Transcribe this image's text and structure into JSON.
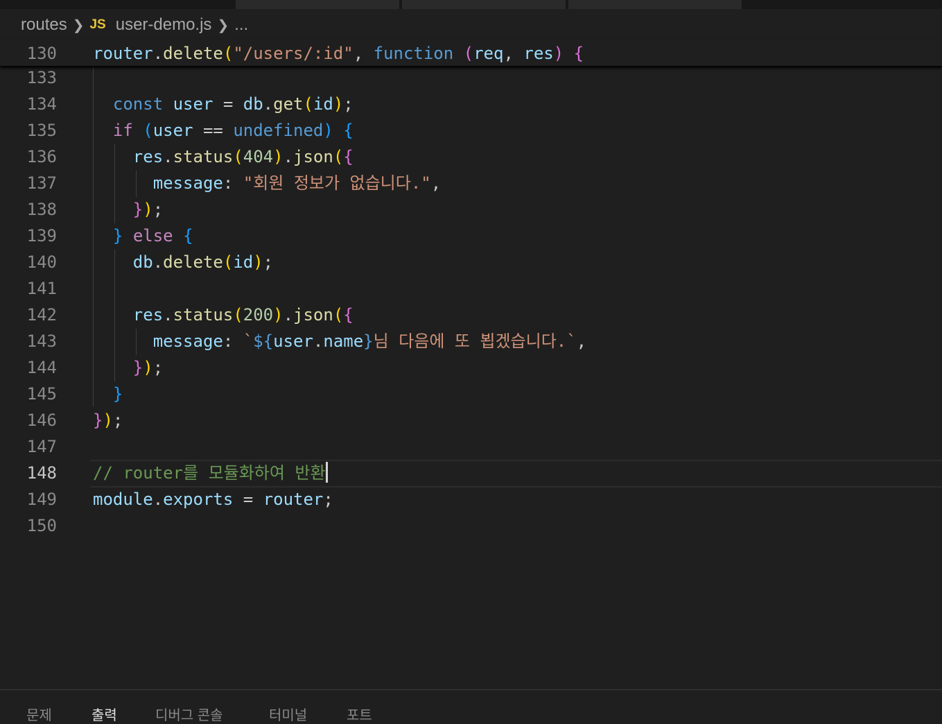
{
  "breadcrumb": {
    "folder": "routes",
    "file_icon": "JS",
    "file": "user-demo.js",
    "more": "..."
  },
  "editor": {
    "active_line": "148",
    "lines": [
      {
        "num": "130",
        "text": "router.delete(\"/users/:id\", function (req, res) {"
      },
      {
        "num": "133",
        "text": ""
      },
      {
        "num": "134",
        "text": "  const user = db.get(id);"
      },
      {
        "num": "135",
        "text": "  if (user == undefined) {"
      },
      {
        "num": "136",
        "text": "    res.status(404).json({"
      },
      {
        "num": "137",
        "text": "      message: \"회원 정보가 없습니다.\","
      },
      {
        "num": "138",
        "text": "    });"
      },
      {
        "num": "139",
        "text": "  } else {"
      },
      {
        "num": "140",
        "text": "    db.delete(id);"
      },
      {
        "num": "141",
        "text": ""
      },
      {
        "num": "142",
        "text": "    res.status(200).json({"
      },
      {
        "num": "143",
        "text": "      message: `${user.name}님 다음에 또 뵙겠습니다.`,"
      },
      {
        "num": "144",
        "text": "    });"
      },
      {
        "num": "145",
        "text": "  }"
      },
      {
        "num": "146",
        "text": "});"
      },
      {
        "num": "147",
        "text": ""
      },
      {
        "num": "148",
        "text": "// router를 모듈화하여 반환"
      },
      {
        "num": "149",
        "text": "module.exports = router;"
      },
      {
        "num": "150",
        "text": ""
      }
    ]
  },
  "panel": {
    "tabs": [
      "문제",
      "출력",
      "디버그 콘솔",
      "터미널",
      "포트"
    ],
    "active_tab": "출력"
  },
  "colors": {
    "background": "#1f1f1f",
    "variable": "#9cdcfe",
    "function": "#dcdcaa",
    "string": "#ce9178",
    "keyword": "#569cd6",
    "control": "#c586c0",
    "number": "#b5cea8",
    "comment": "#6a9955",
    "js_icon": "#e8c33b"
  }
}
